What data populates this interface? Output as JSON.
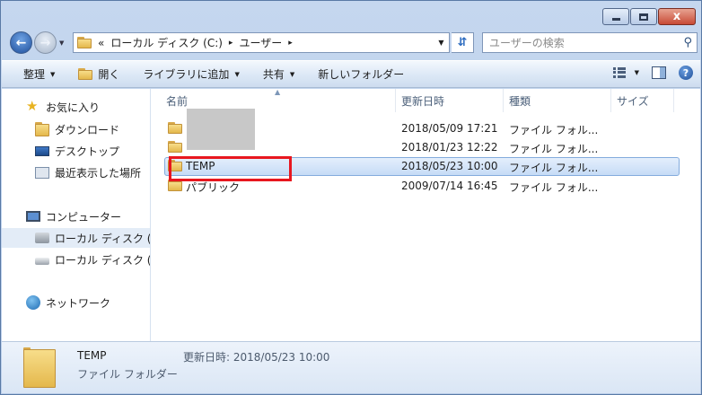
{
  "window": {
    "caption_min": "–",
    "caption_close": "x"
  },
  "address": {
    "overflow": "«",
    "crumbs": [
      "ローカル ディスク (C:)",
      "ユーザー"
    ],
    "separator": "▸"
  },
  "search": {
    "placeholder": "ユーザーの検索"
  },
  "toolbar": {
    "organize": "整理",
    "open": "開く",
    "add_to_library": "ライブラリに追加",
    "share": "共有",
    "new_folder": "新しいフォルダー",
    "help": "?"
  },
  "sidebar": {
    "favorites": "お気に入り",
    "downloads": "ダウンロード",
    "desktop": "デスクトップ",
    "recent": "最近表示した場所",
    "computer": "コンピューター",
    "local_disk_1": "ローカル ディスク (",
    "local_disk_2": "ローカル ディスク (",
    "network": "ネットワーク"
  },
  "columns": {
    "name": "名前",
    "modified": "更新日時",
    "type": "種類",
    "size": "サイズ"
  },
  "files": [
    {
      "name": "",
      "modified": "2018/05/09 17:21",
      "type": "ファイル フォル..."
    },
    {
      "name": "",
      "modified": "2018/01/23 12:22",
      "type": "ファイル フォル..."
    },
    {
      "name": "TEMP",
      "modified": "2018/05/23 10:00",
      "type": "ファイル フォル..."
    },
    {
      "name": "パブリック",
      "modified": "2009/07/14 16:45",
      "type": "ファイル フォル..."
    }
  ],
  "details": {
    "name": "TEMP",
    "type": "ファイル フォルダー",
    "modified_label": "更新日時:",
    "modified_value": "2018/05/23 10:00"
  },
  "annotation": {
    "highlight_color": "#e8171f"
  }
}
